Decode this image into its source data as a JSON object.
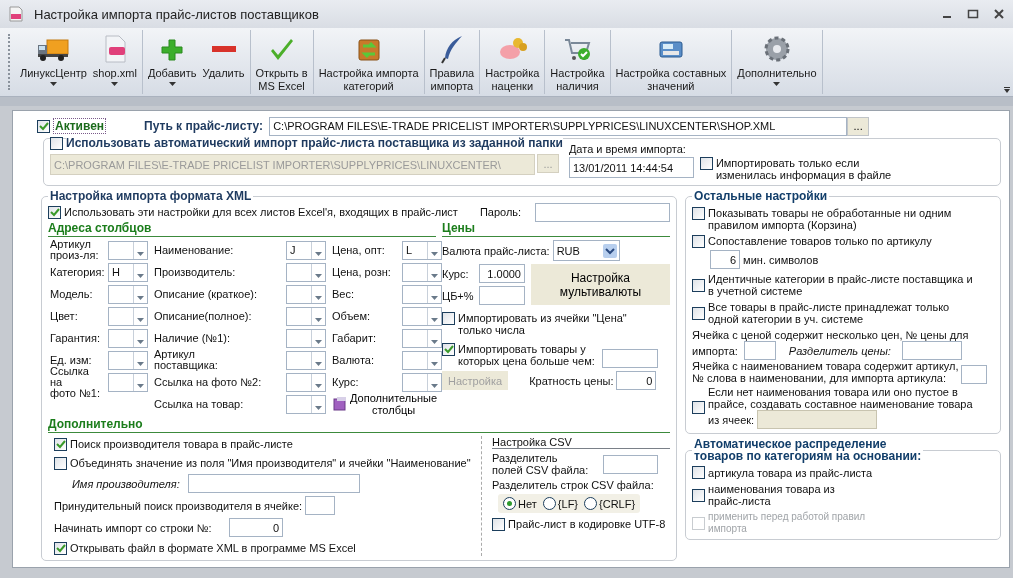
{
  "window": {
    "title": "Настройка импорта прайс-листов поставщиков"
  },
  "toolbar": [
    [
      {
        "label": "ЛинуксЦентр",
        "dropdown": true
      },
      {
        "label": "shop.xml",
        "dropdown": true
      }
    ],
    [
      {
        "label": "Добавить",
        "dropdown": true
      },
      {
        "label": "Удалить",
        "dropdown": false
      }
    ],
    [
      {
        "label": "Открыть в\nMS Excel",
        "dropdown": false
      }
    ],
    [
      {
        "label": "Настройка импорта\nкатегорий",
        "dropdown": false
      }
    ],
    [
      {
        "label": "Правила\nимпорта",
        "dropdown": false
      }
    ],
    [
      {
        "label": "Настройка\nнаценки",
        "dropdown": false
      }
    ],
    [
      {
        "label": "Настройка\nналичия",
        "dropdown": false
      }
    ],
    [
      {
        "label": "Настройка составных\nзначений",
        "dropdown": false
      }
    ],
    [
      {
        "label": "Дополнительно",
        "dropdown": true
      }
    ]
  ],
  "active": {
    "label": "Активен",
    "checked": true
  },
  "path": {
    "label": "Путь к прайс-листу:",
    "value": "C:\\PROGRAM FILES\\E-TRADE PRICELIST IMPORTER\\SUPPLYPRICES\\LINUXCENTER\\SHOP.XML",
    "button": "..."
  },
  "auto_import": {
    "label": "Использовать автоматический импорт прайс-листа поставщика из заданной папки",
    "checked": false,
    "folder": "C:\\PROGRAM FILES\\E-TRADE PRICELIST IMPORTER\\SUPPLYPRICES\\LINUXCENTER\\",
    "button": "..."
  },
  "import_date": {
    "label": "Дата и время импорта:",
    "value": "13/01/2011 14:44:54"
  },
  "only_if_changed": {
    "label": "Импортировать только если\nизменилась информация в файле",
    "checked": false
  },
  "xml": {
    "title": "Настройка импорта формата XML",
    "use_all_sheets": {
      "label": "Использовать эти настройки для всех листов Excel'я, входящих в прайс-лист",
      "checked": true
    },
    "password": {
      "label": "Пароль:"
    },
    "columns": {
      "title": "Адреса столбцов",
      "fields": [
        [
          {
            "label": "Артикул\nпроиз-ля:"
          },
          {
            "label": "Категория:",
            "value": "H"
          },
          {
            "label": "Модель:"
          },
          {
            "label": "Цвет:"
          },
          {
            "label": "Гарантия:"
          },
          {
            "label": "Ед. изм:"
          },
          {
            "label": "Ссылка на\nфото №1:"
          }
        ],
        [
          {
            "label": "Наименование:",
            "value": "J"
          },
          {
            "label": "Производитель:"
          },
          {
            "label": "Описание (краткое):"
          },
          {
            "label": "Описание(полное):"
          },
          {
            "label": "Наличие (№1):"
          },
          {
            "label": "Артикул\nпоставщика:"
          },
          {
            "label": "Ссылка на фото №2:"
          },
          {
            "label": "Ссылка на товар:"
          }
        ],
        [
          {
            "label": "Цена, опт:",
            "value": "L"
          },
          {
            "label": "Цена, розн:"
          },
          {
            "label": "Вес:"
          },
          {
            "label": "Объем:"
          },
          {
            "label": "Габарит:"
          },
          {
            "label": "Валюта:"
          },
          {
            "label": "Курс:"
          }
        ]
      ],
      "extra_button": "Дополнительные\nстолбцы"
    },
    "prices": {
      "title": "Цены",
      "currency": {
        "label": "Валюта прайс-листа:",
        "value": "RUB"
      },
      "rate": {
        "label": "Курс:",
        "value": "1.0000"
      },
      "cb": {
        "label": "ЦБ+%"
      },
      "multicurrency_button": "Настройка\nмультивалюты",
      "numbers_only": {
        "label": "Импортировать из ячейки \"Цена\"\nтолько числа",
        "checked": false
      },
      "min_price": {
        "label": "Импортировать товары у\nкоторых цена больше чем:",
        "checked": true
      },
      "settings_button": {
        "label": "Настройка",
        "disabled": true
      },
      "multiplicity": {
        "label": "Кратность цены:",
        "value": "0"
      }
    },
    "additional": {
      "title": "Дополнительно",
      "search_manufacturer": {
        "label": "Поиск производителя товара в прайс-листе",
        "checked": true
      },
      "merge": {
        "label": "Объединять значение из поля \"Имя производителя\" и ячейки \"Наименование\"",
        "checked": false
      },
      "manufacturer_name": {
        "label": "Имя производителя:"
      },
      "forced_search": {
        "label": "Принудительный поиск производителя в ячейке:"
      },
      "start_row": {
        "label": "Начинать импорт со строки №:",
        "value": "0"
      },
      "open_excel": {
        "label": "Открывать файл в формате XML в программе MS Excel",
        "checked": true
      }
    },
    "csv": {
      "title": "Настройка CSV",
      "field_sep": {
        "label": "Разделитель\nполей CSV файла:"
      },
      "row_sep_label": "Разделитель строк CSV файла:",
      "row_sep": [
        {
          "label": "Нет",
          "selected": true
        },
        {
          "label": "{LF}",
          "selected": false
        },
        {
          "label": "{CRLF}",
          "selected": false
        }
      ],
      "utf8": {
        "label": "Прайс-лист в кодировке UTF-8",
        "checked": false
      }
    }
  },
  "other": {
    "title": "Остальные настройки",
    "options": [
      {
        "label": "Показывать товары не обработанные ни одним\nправилом импорта (Корзина)",
        "checked": false
      },
      {
        "label": "Сопоставление товаров только по артикулу",
        "checked": false
      }
    ],
    "min_chars": {
      "value": "6",
      "label": "мин. символов"
    },
    "options2": [
      {
        "label": "Идентичные категории в прайс-листе поставщика и\nв учетной системе",
        "checked": false
      },
      {
        "label": "Все товары в прайс-листе принадлежат только\nодной категории в уч. системе",
        "checked": false
      }
    ],
    "multi_price": {
      "label": "Ячейка с ценой содержит несколько цен, № цены для",
      "label_end": "импорта:",
      "separator_label": "Разделитель цены:"
    },
    "article_in_name": {
      "label": "Ячейка с наименованием товара содержит артикул,\n№ слова в наименовании, для импорта артикула:"
    },
    "compose_name": {
      "label": "Если нет наименования товара или оно пустое в\nпрайсе, создавать составное наименование товара",
      "cells_label": "из ячеек:",
      "checked": false
    }
  },
  "auto_distribution": {
    "title": "Автоматическое распределение\nтоваров по категориям на основании:",
    "options": [
      {
        "label": "артикула товара из прайс-листа",
        "checked": false,
        "disabled": false
      },
      {
        "label": "наименования товара из\nпрайс-листа",
        "checked": false,
        "disabled": false
      },
      {
        "label": "применить перед работой правил\nимпорта",
        "checked": false,
        "disabled": true
      }
    ]
  }
}
